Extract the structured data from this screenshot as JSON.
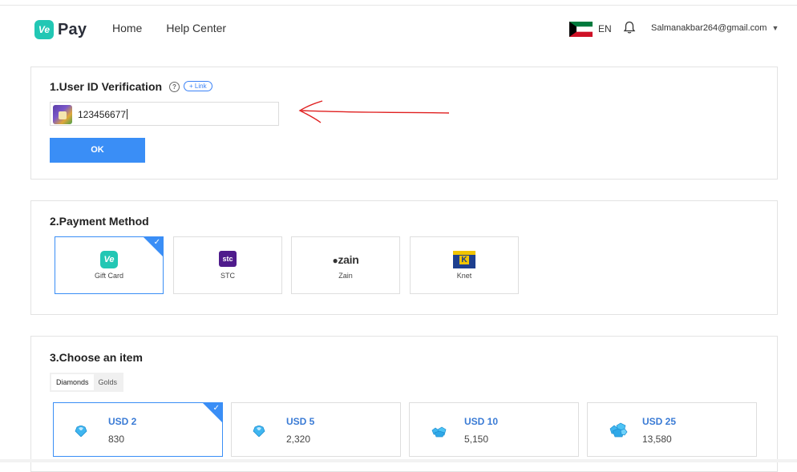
{
  "header": {
    "logo_badge": "Ve",
    "logo_text": "Pay",
    "nav": [
      "Home",
      "Help Center"
    ],
    "language": "EN",
    "account_email": "Salmanakbar264@gmail.com",
    "caret": "▼"
  },
  "verification": {
    "title": "1.User ID Verification",
    "help_glyph": "?",
    "link_label": "+ Link",
    "user_id": "123456677",
    "ok_label": "OK"
  },
  "payment": {
    "title": "2.Payment Method",
    "methods": [
      {
        "label": "Gift Card",
        "selected": true
      },
      {
        "label": "STC",
        "logo_text": "stc"
      },
      {
        "label": "Zain",
        "logo_text": "zain"
      },
      {
        "label": "Knet",
        "logo_text": "K"
      }
    ]
  },
  "items": {
    "title": "3.Choose an item",
    "tabs": [
      "Diamonds",
      "Golds"
    ],
    "list": [
      {
        "price": "USD 2",
        "amount": "830",
        "selected": true
      },
      {
        "price": "USD 5",
        "amount": "2,320"
      },
      {
        "price": "USD 10",
        "amount": "5,150"
      },
      {
        "price": "USD 25",
        "amount": "13,580"
      }
    ]
  },
  "colors": {
    "accent": "#3a8ef6",
    "brand": "#22c7b4",
    "annotation_arrow": "#e02020"
  }
}
